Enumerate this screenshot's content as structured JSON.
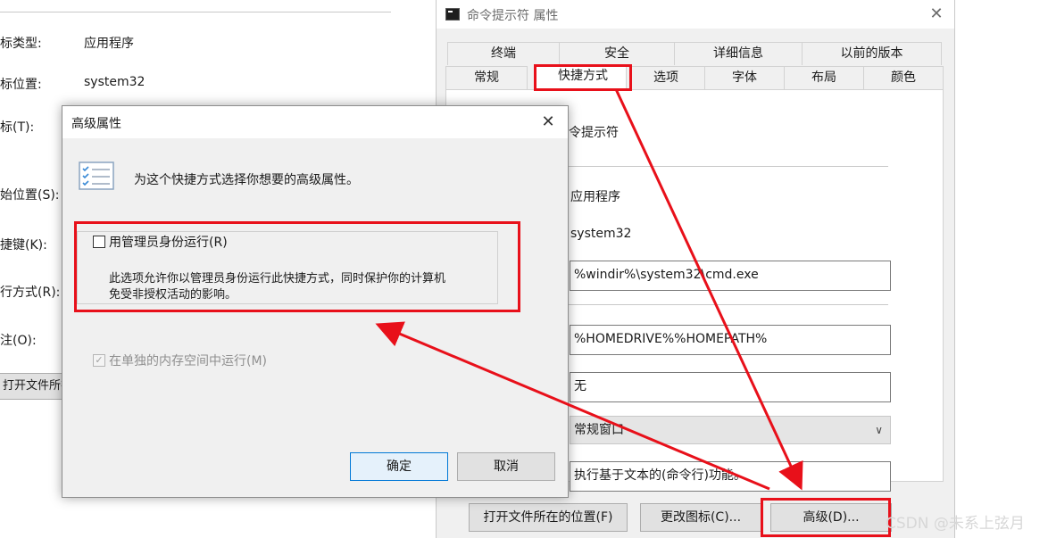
{
  "background_window": {
    "labels": [
      "标类型:",
      "标位置:",
      "标(T):",
      "始位置(S):",
      "捷键(K):",
      "行方式(R):",
      "注(O):"
    ],
    "values": [
      "应用程序",
      "system32"
    ],
    "open_location_button": "打开文件所在"
  },
  "main_window": {
    "title": "命令提示符 属性",
    "close_label": "✕",
    "tabs_row_top": [
      "终端",
      "安全",
      "详细信息",
      "以前的版本"
    ],
    "tabs_row_bottom": [
      "常规",
      "快捷方式",
      "选项",
      "字体",
      "布局",
      "颜色"
    ],
    "active_tab": "快捷方式",
    "shortcut_name": "命令提示符",
    "target_type": "应用程序",
    "target_location": "system32",
    "target": "%windir%\\system32\\cmd.exe",
    "start_in": "%HOMEDRIVE%%HOMEPATH%",
    "shortcut_key": "无",
    "run": "常规窗口",
    "comment": "执行基于文本的(命令行)功能。",
    "buttons": {
      "open_location": "打开文件所在的位置(F)",
      "change_icon": "更改图标(C)...",
      "advanced": "高级(D)..."
    }
  },
  "advanced_dialog": {
    "title": "高级属性",
    "close_label": "✕",
    "intro": "为这个快捷方式选择你想要的高级属性。",
    "run_as_admin": {
      "label": "用管理员身份运行(R)",
      "checked": false,
      "description_line1": "此选项允许你以管理员身份运行此快捷方式，同时保护你的计算机",
      "description_line2": "免受非授权活动的影响。"
    },
    "separate_memory": {
      "label": "在单独的内存空间中运行(M)",
      "checked": true,
      "enabled": false
    },
    "ok_button": "确定",
    "cancel_button": "取消"
  },
  "annotation_color": "#e8101a",
  "watermark": "CSDN @未系上弦月"
}
